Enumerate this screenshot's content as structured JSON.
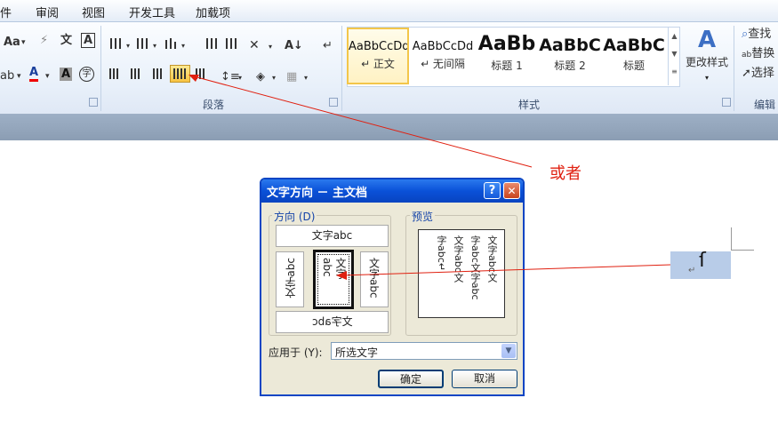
{
  "tabs": [
    "件",
    "审阅",
    "视图",
    "开发工具",
    "加载项"
  ],
  "ribbon": {
    "paragraph_group": "段落",
    "styles_group": "样式",
    "edit_group": "编辑",
    "styles": [
      {
        "preview": "AaBbCcDd",
        "label": "↵ 正文"
      },
      {
        "preview": "AaBbCcDd",
        "label": "↵ 无间隔"
      },
      {
        "preview": "AaBb",
        "label": "标题 1"
      },
      {
        "preview": "AaBbC",
        "label": "标题 2"
      },
      {
        "preview": "AaBbC",
        "label": "标题"
      }
    ],
    "change_styles": "更改样式",
    "find": "查找",
    "replace": "替换",
    "select": "选择",
    "font_size_btn": "Aa",
    "phonetic_glyph": "文",
    "char_border": "A",
    "font_color_a": "A",
    "shade_a": "A",
    "enclose_char": "字"
  },
  "annotation": {
    "text": "或者",
    "color": "#e02010"
  },
  "dialog": {
    "title": "文字方向 － 主文档",
    "help": "?",
    "close": "✕",
    "direction_label": "方向 (D)",
    "preview_label": "预览",
    "opt_horizontal": "文字abc",
    "opt_rotate_left": "文字abc",
    "opt_vertical_line1": "文字",
    "opt_vertical_line2": "abc",
    "opt_rotate_right": "文字abc",
    "opt_horizontal_flipped": "文字abc",
    "preview_cols": [
      "文字abc文",
      "字abc文字abc",
      "文字abc文",
      "字abc↵"
    ],
    "apply_label": "应用于 (Y):",
    "apply_value": "所选文字",
    "ok": "确定",
    "cancel": "取消"
  },
  "doc": {
    "selected_glyph": "ſ",
    "return_mark": "↵"
  }
}
